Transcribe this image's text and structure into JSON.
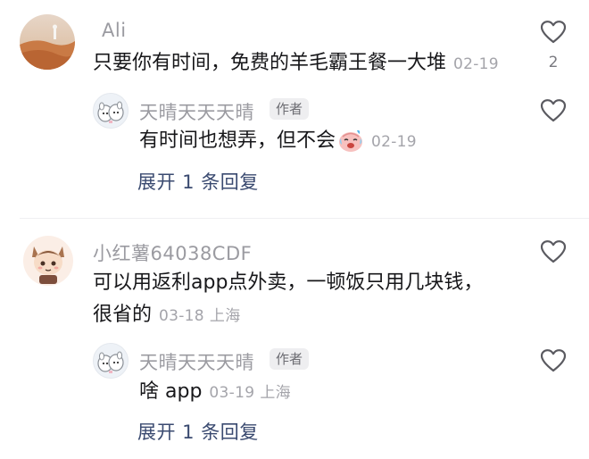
{
  "comments": [
    {
      "username": "Ali",
      "text": "只要你有时间，免费的羊毛霸王餐一大堆",
      "date": "02-19",
      "like_count": "2",
      "reply": {
        "username": "天晴天天天晴",
        "badge": "作者",
        "text": "有时间也想弄，但不会",
        "date": "02-19"
      },
      "expand_label": "展开 1 条回复"
    },
    {
      "username": "小红薯64038CDF",
      "text_line1": "可以用返利app点外卖，一顿饭只用几块钱，",
      "text_line2": "很省的",
      "date": "03-18",
      "location": "上海",
      "reply": {
        "username": "天晴天天天晴",
        "badge": "作者",
        "text": "啥 app",
        "date": "03-19",
        "location": "上海"
      },
      "expand_label": "展开 1 条回复"
    }
  ],
  "icons": {
    "like": "heart-outline-icon",
    "emoji": "crying-face-emoji"
  },
  "colors": {
    "username": "#9b9ba1",
    "text": "#17171a",
    "meta": "#a4a4aa",
    "expand": "#3a4a70"
  }
}
